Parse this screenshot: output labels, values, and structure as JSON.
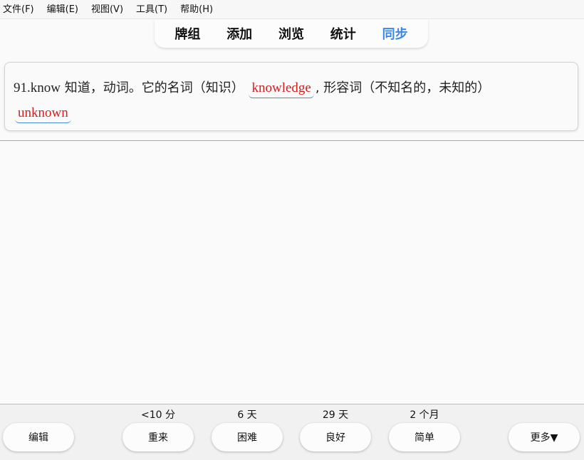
{
  "menu": [
    "文件(F)",
    "编辑(E)",
    "视图(V)",
    "工具(T)",
    "帮助(H)"
  ],
  "toolbar": {
    "decks": "牌组",
    "add": "添加",
    "browse": "浏览",
    "stats": "统计",
    "sync": "同步",
    "sync_color": "#3b87ea"
  },
  "card": {
    "prefix": "91.know",
    "text1": " 知道，动词。它的名词（知识）",
    "cloze1": "knowledge",
    "text2": ", 形容词（不知名的，未知的）",
    "cloze2": "unknown",
    "cloze_color": "#d31f1f"
  },
  "bottom": {
    "edit": "编辑",
    "again_ivl": "<10 分",
    "again": "重来",
    "hard_ivl": "6 天",
    "hard": "困难",
    "good_ivl": "29 天",
    "good": "良好",
    "easy_ivl": "2 个月",
    "easy": "简单",
    "more": "更多▼"
  }
}
